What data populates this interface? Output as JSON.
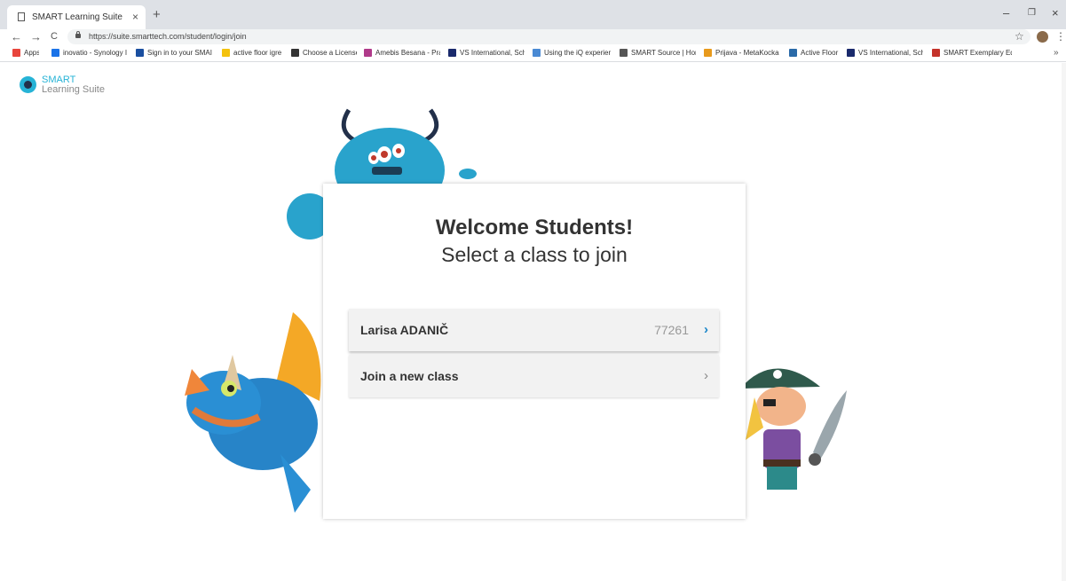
{
  "browser": {
    "tab_title": "SMART Learning Suite Online",
    "tab_close": "×",
    "new_tab": "+",
    "address": "https://suite.smarttech.com/student/login/join",
    "nav": {
      "back": "←",
      "forward": "→",
      "reload": "C"
    },
    "window": {
      "minimize": "–",
      "restore": "❐",
      "close": "×"
    },
    "star": "☆",
    "menu": "⋮",
    "bookmarks": [
      {
        "label": "Apps",
        "color": "#e8453c"
      },
      {
        "label": "inovatio - Synology I",
        "color": "#1a73e8"
      },
      {
        "label": "Sign in to your SMAI",
        "color": "#1a4fa0"
      },
      {
        "label": "active floor igre",
        "color": "#f4c20d"
      },
      {
        "label": "Choose a License",
        "color": "#333333"
      },
      {
        "label": "Amebis Besana - Pra",
        "color": "#b03a8a"
      },
      {
        "label": "VS International, Sch",
        "color": "#1a2a6c"
      },
      {
        "label": "Using the iQ experier",
        "color": "#4a8ad4"
      },
      {
        "label": "SMART Source | Hom",
        "color": "#555555"
      },
      {
        "label": "Prijava - MetaKocka",
        "color": "#e89a1c"
      },
      {
        "label": "Active Floor",
        "color": "#2a6aa8"
      },
      {
        "label": "VS International, Sch",
        "color": "#1a2a6c"
      },
      {
        "label": "SMART Exemplary Ed",
        "color": "#c4322a"
      }
    ],
    "bookmarks_more": "»"
  },
  "logo": {
    "line1": "SMART",
    "line2": "Learning Suite"
  },
  "card": {
    "title": "Welcome Students!",
    "subtitle": "Select a class to join",
    "classes": [
      {
        "name": "Larisa ADANIČ",
        "code": "77261",
        "chevron": "›"
      }
    ],
    "join_new": {
      "label": "Join a new class",
      "chevron": "›"
    }
  },
  "colors": {
    "accent": "#26b3d6",
    "link": "#1a86c9"
  }
}
